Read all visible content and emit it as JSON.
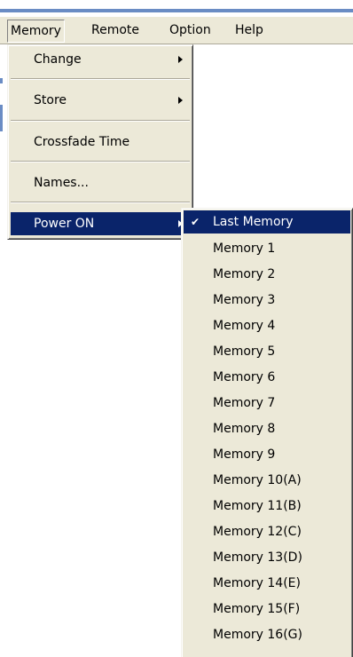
{
  "menubar": {
    "items": [
      {
        "label": "Memory"
      },
      {
        "label": "Remote"
      },
      {
        "label": "Option"
      },
      {
        "label": "Help"
      }
    ]
  },
  "memory_menu": {
    "items": [
      {
        "label": "Change",
        "submenu": true
      },
      {
        "label": "Store",
        "submenu": true
      },
      {
        "label": "Crossfade Time",
        "submenu": false
      },
      {
        "label": "Names...",
        "submenu": false
      },
      {
        "label": "Power ON",
        "submenu": true,
        "highlighted": true
      }
    ]
  },
  "power_on_menu": {
    "items": [
      {
        "label": "Last Memory",
        "checked": true,
        "highlighted": true
      },
      {
        "label": "Memory 1"
      },
      {
        "label": "Memory 2"
      },
      {
        "label": "Memory 3"
      },
      {
        "label": "Memory 4"
      },
      {
        "label": "Memory 5"
      },
      {
        "label": "Memory 6"
      },
      {
        "label": "Memory 7"
      },
      {
        "label": "Memory 8"
      },
      {
        "label": "Memory 9"
      },
      {
        "label": "Memory 10(A)"
      },
      {
        "label": "Memory 11(B)"
      },
      {
        "label": "Memory 12(C)"
      },
      {
        "label": "Memory 13(D)"
      },
      {
        "label": "Memory 14(E)"
      },
      {
        "label": "Memory 15(F)"
      },
      {
        "label": "Memory 16(G)"
      }
    ],
    "check_glyph": "✔"
  },
  "colors": {
    "menu_bg": "#ece9d8",
    "highlight": "#0a246a",
    "highlight_text": "#ffffff"
  }
}
